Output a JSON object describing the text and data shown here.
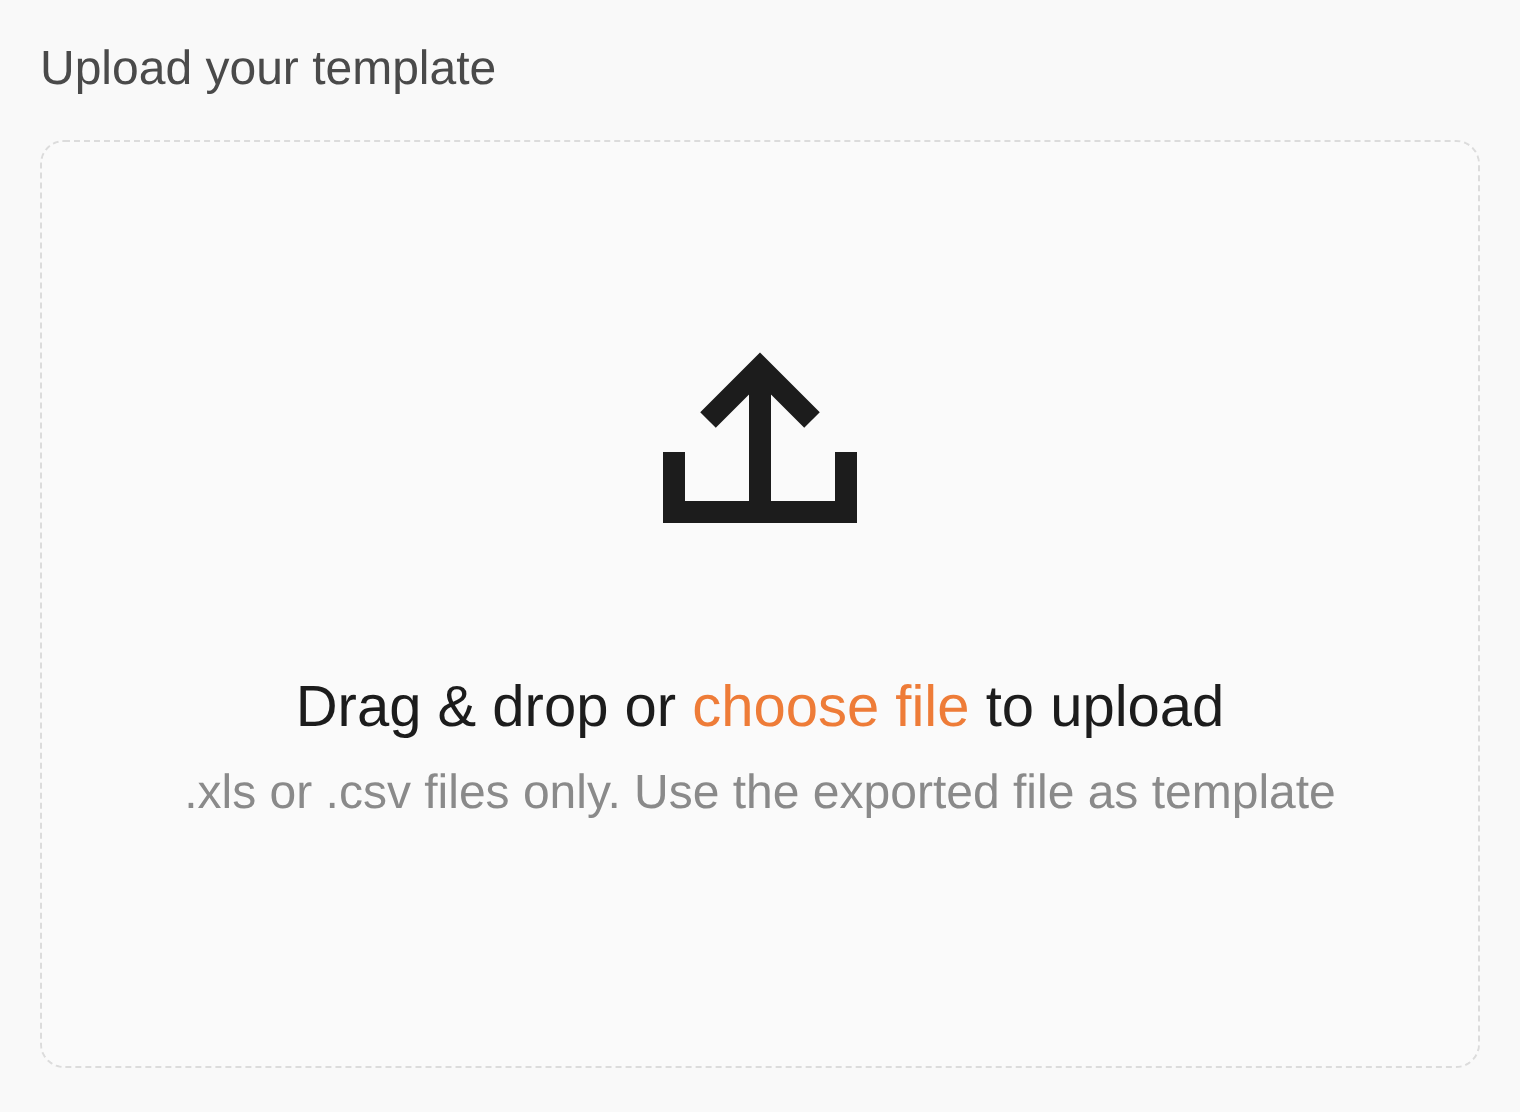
{
  "title": "Upload your template",
  "dropzone": {
    "prompt_before": "Drag & drop or ",
    "link": "choose file",
    "prompt_after": " to upload",
    "hint": ".xls or .csv files only. Use the exported file as template"
  }
}
